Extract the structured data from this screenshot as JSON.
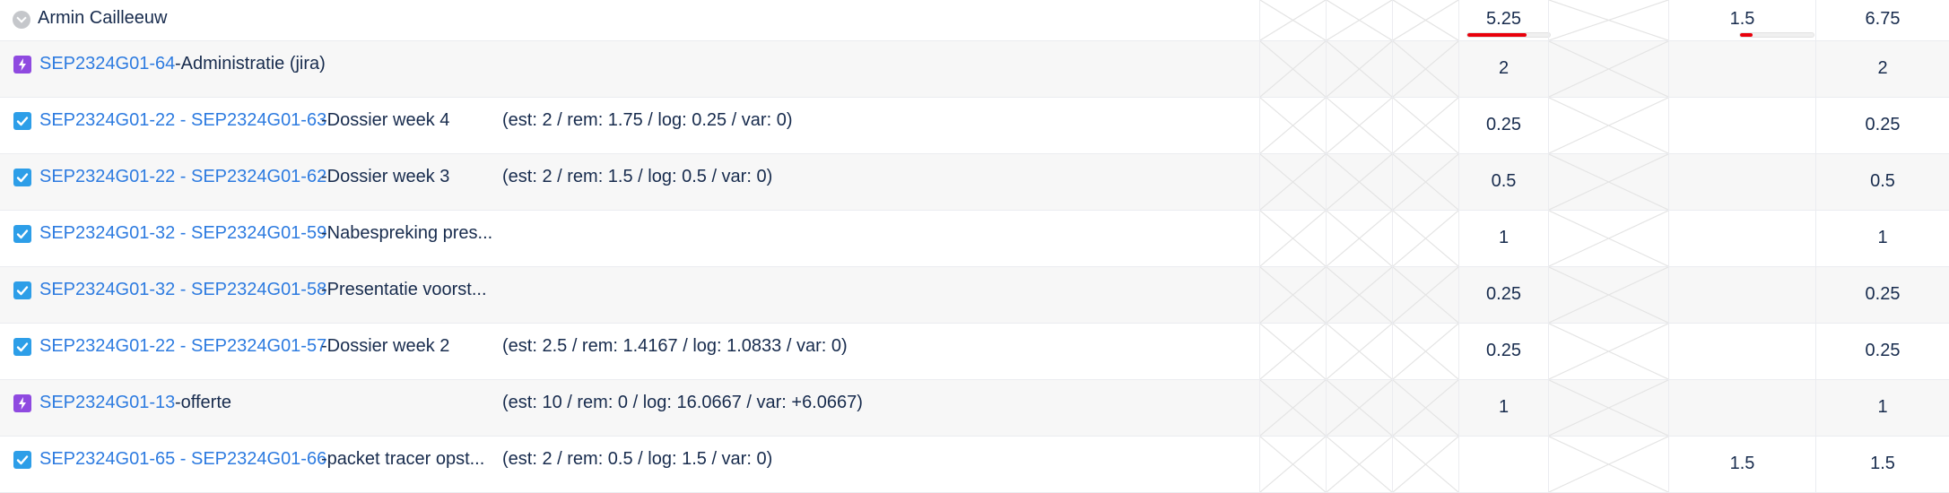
{
  "person": {
    "name": "Armin Cailleeuw",
    "total_a": "5.25",
    "total_b": "1.5",
    "total_c": "6.75",
    "progress_a": 0.72,
    "progress_b": 0.17
  },
  "rows": [
    {
      "type": "epic",
      "key": "SEP2324G01-64",
      "summary": "-Administratie (jira)",
      "estimate": "",
      "values": {
        "a": "2",
        "b": "",
        "c": "2"
      }
    },
    {
      "type": "story",
      "key": "SEP2324G01-22 - SEP2324G01-63",
      "summary": "-Dossier week 4",
      "estimate": "(est: 2 / rem: 1.75 / log: 0.25 / var: 0)",
      "values": {
        "a": "0.25",
        "b": "",
        "c": "0.25"
      }
    },
    {
      "type": "story",
      "key": "SEP2324G01-22 - SEP2324G01-62",
      "summary": "-Dossier week 3",
      "estimate": "(est: 2 / rem: 1.5 / log: 0.5 / var: 0)",
      "values": {
        "a": "0.5",
        "b": "",
        "c": "0.5"
      }
    },
    {
      "type": "story",
      "key": "SEP2324G01-32 - SEP2324G01-59",
      "summary": "-Nabespreking pres...",
      "estimate": "",
      "values": {
        "a": "1",
        "b": "",
        "c": "1"
      }
    },
    {
      "type": "story",
      "key": "SEP2324G01-32 - SEP2324G01-58",
      "summary": "-Presentatie voorst...",
      "estimate": "",
      "values": {
        "a": "0.25",
        "b": "",
        "c": "0.25"
      }
    },
    {
      "type": "story",
      "key": "SEP2324G01-22 - SEP2324G01-57",
      "summary": "-Dossier week 2",
      "estimate": "(est: 2.5 / rem: 1.4167 / log: 1.0833 / var: 0)",
      "values": {
        "a": "0.25",
        "b": "",
        "c": "0.25"
      }
    },
    {
      "type": "epic",
      "key": "SEP2324G01-13",
      "summary": "-offerte",
      "estimate": "(est: 10 / rem: 0 / log: 16.0667 / var: +6.0667)",
      "values": {
        "a": "1",
        "b": "",
        "c": "1"
      }
    },
    {
      "type": "story",
      "key": "SEP2324G01-65 - SEP2324G01-66",
      "summary": "-packet tracer opst...",
      "estimate": "(est: 2 / rem: 0.5 / log: 1.5 / var: 0)",
      "values": {
        "a": "",
        "b": "1.5",
        "c": "1.5"
      }
    }
  ],
  "colors": {
    "link": "#2d7be0",
    "progress_fill": "#e8000b",
    "story_icon": "#2d9ee8",
    "epic_icon": "#8f4ae0",
    "alt_row": "#f7f7f7"
  },
  "icons": {
    "collapse": "chevron-down-icon",
    "story": "checkbox-icon",
    "epic": "lightning-icon"
  }
}
